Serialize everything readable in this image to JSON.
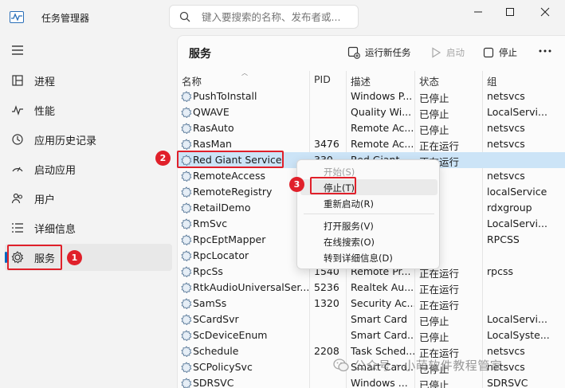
{
  "window": {
    "title": "任务管理器",
    "search_placeholder": "键入要搜索的名称、发布者或..."
  },
  "sidebar": {
    "items": [
      {
        "label": "进程",
        "icon": "processes-icon"
      },
      {
        "label": "性能",
        "icon": "performance-icon"
      },
      {
        "label": "应用历史记录",
        "icon": "app-history-icon"
      },
      {
        "label": "启动应用",
        "icon": "startup-apps-icon"
      },
      {
        "label": "用户",
        "icon": "users-icon"
      },
      {
        "label": "详细信息",
        "icon": "details-icon"
      },
      {
        "label": "服务",
        "icon": "services-icon"
      }
    ],
    "active_index": 6
  },
  "main": {
    "title": "服务",
    "toolbar": {
      "run_new_task": "运行新任务",
      "start": "启动",
      "stop": "停止"
    }
  },
  "table": {
    "columns": [
      "名称",
      "PID",
      "描述",
      "状态",
      "组"
    ],
    "rows": [
      {
        "name": "PushToInstall",
        "pid": "",
        "desc": "Windows P...",
        "status": "已停止",
        "group": "netsvcs"
      },
      {
        "name": "QWAVE",
        "pid": "",
        "desc": "Quality Wi...",
        "status": "已停止",
        "group": "LocalServi..."
      },
      {
        "name": "RasAuto",
        "pid": "",
        "desc": "Remote Ac...",
        "status": "已停止",
        "group": "netsvcs"
      },
      {
        "name": "RasMan",
        "pid": "3476",
        "desc": "Remote Ac...",
        "status": "正在运行",
        "group": "netsvcs"
      },
      {
        "name": "Red Giant Service",
        "pid": "330",
        "desc": "Red Giant ...",
        "status": "正在运行",
        "group": ""
      },
      {
        "name": "RemoteAccess",
        "pid": "",
        "desc": "",
        "status": "止",
        "group": "netsvcs"
      },
      {
        "name": "RemoteRegistry",
        "pid": "",
        "desc": "",
        "status": "止",
        "group": "localService"
      },
      {
        "name": "RetailDemo",
        "pid": "",
        "desc": "",
        "status": "止",
        "group": "rdxgroup"
      },
      {
        "name": "RmSvc",
        "pid": "",
        "desc": "",
        "status": "行",
        "group": "LocalServi..."
      },
      {
        "name": "RpcEptMapper",
        "pid": "",
        "desc": "",
        "status": "行",
        "group": "RPCSS"
      },
      {
        "name": "RpcLocator",
        "pid": "",
        "desc": "",
        "status": "止",
        "group": ""
      },
      {
        "name": "RpcSs",
        "pid": "1540",
        "desc": "Remote Pr...",
        "status": "正在运行",
        "group": "rpcss"
      },
      {
        "name": "RtkAudioUniversalSer...",
        "pid": "5236",
        "desc": "Realtek Au...",
        "status": "正在运行",
        "group": ""
      },
      {
        "name": "SamSs",
        "pid": "1320",
        "desc": "Security Ac...",
        "status": "正在运行",
        "group": ""
      },
      {
        "name": "SCardSvr",
        "pid": "",
        "desc": "Smart Card",
        "status": "已停止",
        "group": "LocalServi..."
      },
      {
        "name": "ScDeviceEnum",
        "pid": "",
        "desc": "Smart Card...",
        "status": "已停止",
        "group": "LocalSyste..."
      },
      {
        "name": "Schedule",
        "pid": "2208",
        "desc": "Task Sched...",
        "status": "正在运行",
        "group": "netsvcs"
      },
      {
        "name": "SCPolicySvc",
        "pid": "",
        "desc": "Smart Card...",
        "status": "已停止",
        "group": "netsvcs"
      },
      {
        "name": "SDRSVC",
        "pid": "",
        "desc": "Windows ...",
        "status": "已停止",
        "group": "SDRSVC"
      }
    ],
    "selected_index": 4
  },
  "context_menu": {
    "items": [
      "开始(S)",
      "停止(T)",
      "重新启动(R)",
      "打开服务(V)",
      "在线搜索(O)",
      "转到详细信息(D)"
    ]
  },
  "annotations": [
    "1",
    "2",
    "3"
  ],
  "watermark": "公众号 · 小萌软件教程管家",
  "colors": {
    "accent": "#0067c0",
    "selection": "#cce4f7",
    "annotation": "#e0202a"
  }
}
